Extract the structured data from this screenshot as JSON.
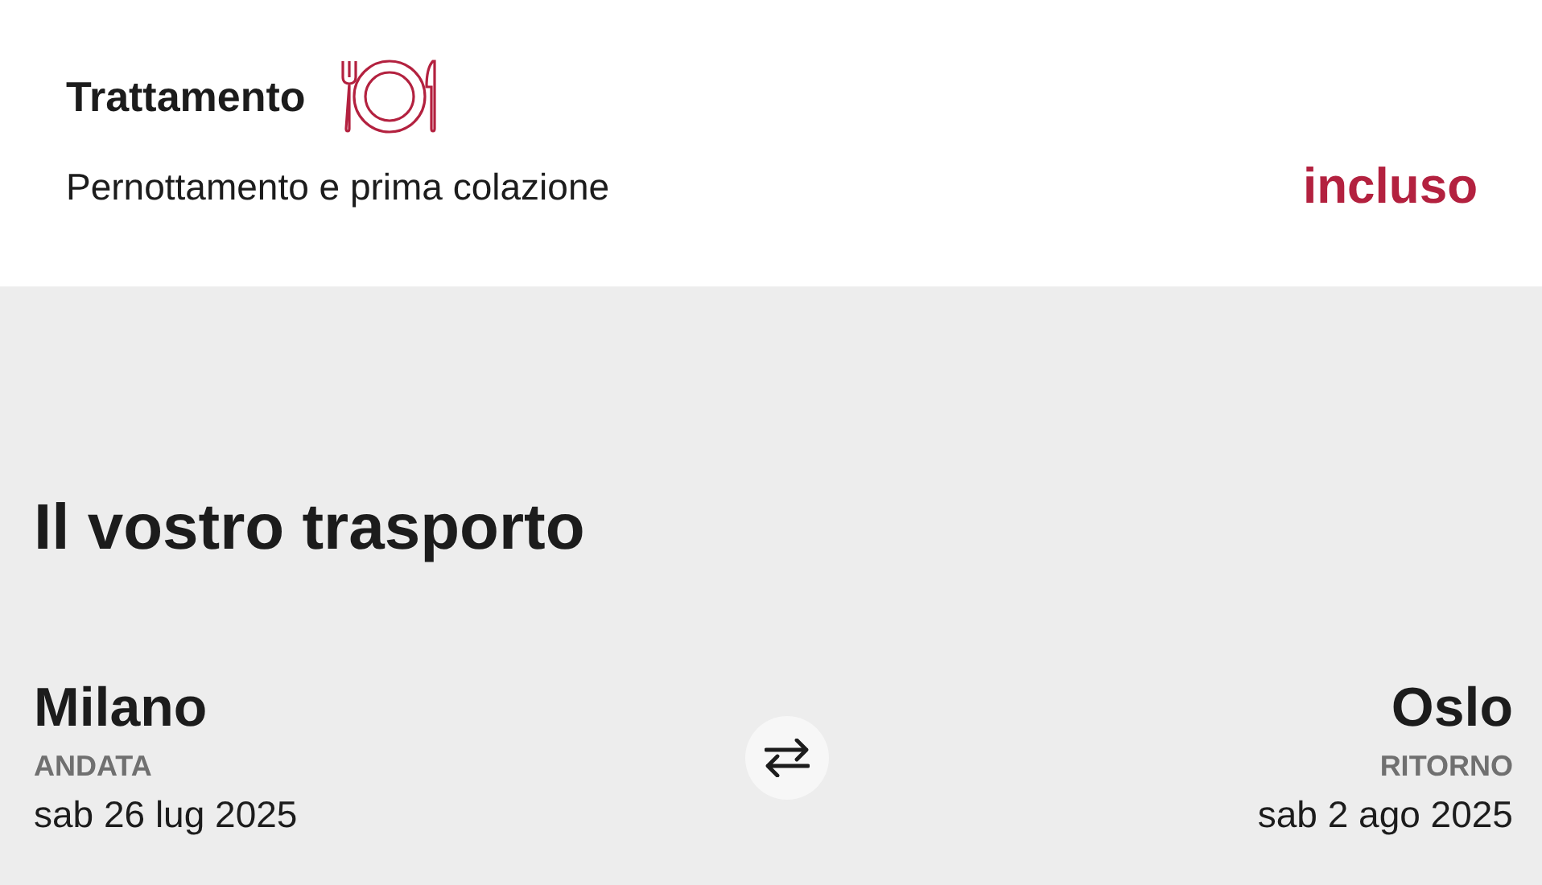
{
  "board": {
    "title": "Trattamento",
    "description": "Pernottamento e prima colazione",
    "price": "incluso"
  },
  "transport": {
    "heading": "Il vostro trasporto",
    "legs": [
      {
        "city": "Milano",
        "label": "ANDATA",
        "date": "sab 26 lug 2025"
      },
      {
        "city": "Oslo",
        "label": "RITORNO",
        "date": "sab 2 ago 2025"
      }
    ]
  }
}
